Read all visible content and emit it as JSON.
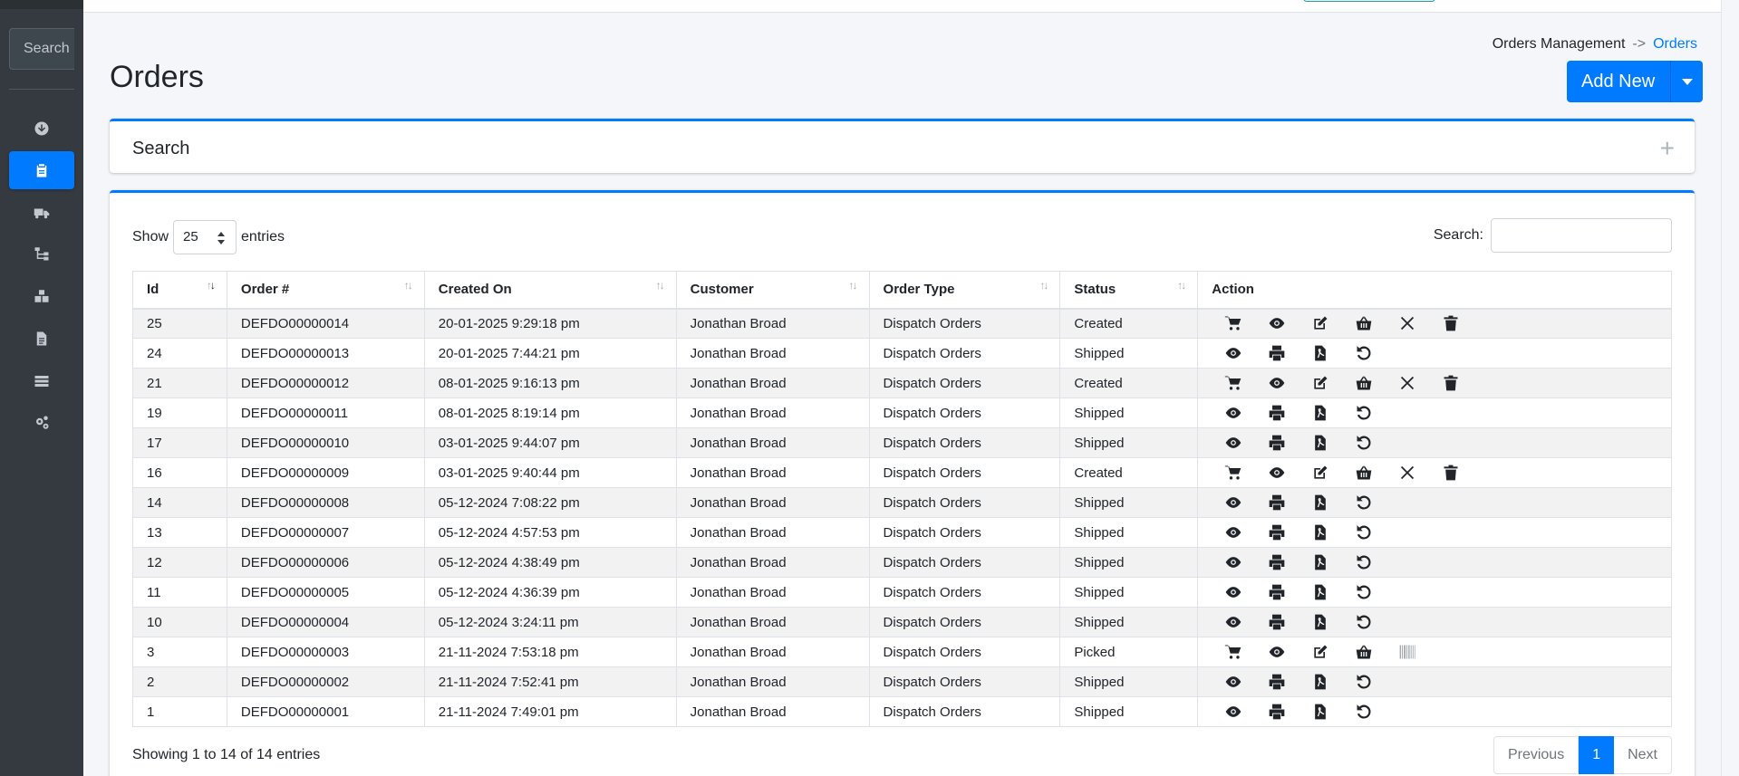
{
  "sidebar": {
    "search_placeholder": "Search",
    "items": [
      {
        "icon": "download-circle-icon",
        "active": false
      },
      {
        "icon": "clipboard-icon",
        "active": true
      },
      {
        "icon": "truck-icon",
        "active": false
      },
      {
        "icon": "sitemap-icon",
        "active": false
      },
      {
        "icon": "boxes-icon",
        "active": false
      },
      {
        "icon": "file-icon",
        "active": false
      },
      {
        "icon": "layers-icon",
        "active": false
      },
      {
        "icon": "cogs-icon",
        "active": false
      }
    ]
  },
  "breadcrumb": {
    "parent": "Orders Management",
    "separator": "->",
    "current": "Orders"
  },
  "page": {
    "title": "Orders",
    "add_new_label": "Add New"
  },
  "search_card": {
    "title": "Search",
    "expand_symbol": "+"
  },
  "table_controls": {
    "show_label": "Show",
    "entries_value": "25",
    "entries_label": "entries",
    "search_label": "Search:"
  },
  "table": {
    "columns": [
      "Id",
      "Order #",
      "Created On",
      "Customer",
      "Order Type",
      "Status",
      "Action"
    ],
    "rows": [
      {
        "id": "25",
        "order": "DEFDO00000014",
        "created": "20-01-2025 9:29:18 pm",
        "customer": "Jonathan Broad",
        "type": "Dispatch Orders",
        "status": "Created",
        "actions": [
          "cart-icon",
          "eye-icon",
          "edit-icon",
          "basket-icon",
          "close-icon",
          "trash-icon"
        ]
      },
      {
        "id": "24",
        "order": "DEFDO00000013",
        "created": "20-01-2025 7:44:21 pm",
        "customer": "Jonathan Broad",
        "type": "Dispatch Orders",
        "status": "Shipped",
        "actions": [
          "eye-icon",
          "print-icon",
          "pdf-icon",
          "undo-icon"
        ]
      },
      {
        "id": "21",
        "order": "DEFDO00000012",
        "created": "08-01-2025 9:16:13 pm",
        "customer": "Jonathan Broad",
        "type": "Dispatch Orders",
        "status": "Created",
        "actions": [
          "cart-icon",
          "eye-icon",
          "edit-icon",
          "basket-icon",
          "close-icon",
          "trash-icon"
        ]
      },
      {
        "id": "19",
        "order": "DEFDO00000011",
        "created": "08-01-2025 8:19:14 pm",
        "customer": "Jonathan Broad",
        "type": "Dispatch Orders",
        "status": "Shipped",
        "actions": [
          "eye-icon",
          "print-icon",
          "pdf-icon",
          "undo-icon"
        ]
      },
      {
        "id": "17",
        "order": "DEFDO00000010",
        "created": "03-01-2025 9:44:07 pm",
        "customer": "Jonathan Broad",
        "type": "Dispatch Orders",
        "status": "Shipped",
        "actions": [
          "eye-icon",
          "print-icon",
          "pdf-icon",
          "undo-icon"
        ]
      },
      {
        "id": "16",
        "order": "DEFDO00000009",
        "created": "03-01-2025 9:40:44 pm",
        "customer": "Jonathan Broad",
        "type": "Dispatch Orders",
        "status": "Created",
        "actions": [
          "cart-icon",
          "eye-icon",
          "edit-icon",
          "basket-icon",
          "close-icon",
          "trash-icon"
        ]
      },
      {
        "id": "14",
        "order": "DEFDO00000008",
        "created": "05-12-2024 7:08:22 pm",
        "customer": "Jonathan Broad",
        "type": "Dispatch Orders",
        "status": "Shipped",
        "actions": [
          "eye-icon",
          "print-icon",
          "pdf-icon",
          "undo-icon"
        ]
      },
      {
        "id": "13",
        "order": "DEFDO00000007",
        "created": "05-12-2024 4:57:53 pm",
        "customer": "Jonathan Broad",
        "type": "Dispatch Orders",
        "status": "Shipped",
        "actions": [
          "eye-icon",
          "print-icon",
          "pdf-icon",
          "undo-icon"
        ]
      },
      {
        "id": "12",
        "order": "DEFDO00000006",
        "created": "05-12-2024 4:38:49 pm",
        "customer": "Jonathan Broad",
        "type": "Dispatch Orders",
        "status": "Shipped",
        "actions": [
          "eye-icon",
          "print-icon",
          "pdf-icon",
          "undo-icon"
        ]
      },
      {
        "id": "11",
        "order": "DEFDO00000005",
        "created": "05-12-2024 4:36:39 pm",
        "customer": "Jonathan Broad",
        "type": "Dispatch Orders",
        "status": "Shipped",
        "actions": [
          "eye-icon",
          "print-icon",
          "pdf-icon",
          "undo-icon"
        ]
      },
      {
        "id": "10",
        "order": "DEFDO00000004",
        "created": "05-12-2024 3:24:11 pm",
        "customer": "Jonathan Broad",
        "type": "Dispatch Orders",
        "status": "Shipped",
        "actions": [
          "eye-icon",
          "print-icon",
          "pdf-icon",
          "undo-icon"
        ]
      },
      {
        "id": "3",
        "order": "DEFDO00000003",
        "created": "21-11-2024 7:53:18 pm",
        "customer": "Jonathan Broad",
        "type": "Dispatch Orders",
        "status": "Picked",
        "actions": [
          "cart-icon",
          "eye-icon",
          "edit-icon",
          "basket-icon",
          "barcode-icon"
        ]
      },
      {
        "id": "2",
        "order": "DEFDO00000002",
        "created": "21-11-2024 7:52:41 pm",
        "customer": "Jonathan Broad",
        "type": "Dispatch Orders",
        "status": "Shipped",
        "actions": [
          "eye-icon",
          "print-icon",
          "pdf-icon",
          "undo-icon"
        ]
      },
      {
        "id": "1",
        "order": "DEFDO00000001",
        "created": "21-11-2024 7:49:01 pm",
        "customer": "Jonathan Broad",
        "type": "Dispatch Orders",
        "status": "Shipped",
        "actions": [
          "eye-icon",
          "print-icon",
          "pdf-icon",
          "undo-icon"
        ]
      }
    ]
  },
  "footer": {
    "info": "Showing 1 to 14 of 14 entries",
    "previous_label": "Previous",
    "current_page": "1",
    "next_label": "Next"
  },
  "colors": {
    "primary": "#007bff",
    "sidebar_bg": "#343a40",
    "page_bg": "#f4f6f9"
  }
}
